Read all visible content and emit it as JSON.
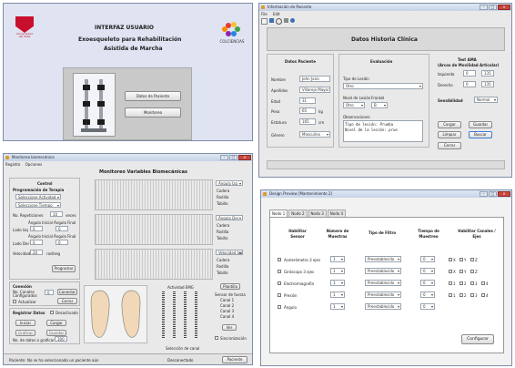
{
  "win1": {
    "title": "INTERFAZ USUARIO",
    "logo_left_text": "Universidad\ndel Valle",
    "subtitle1": "Exoesqueleto para Rehabilitación",
    "subtitle2": "Asistida de Marcha",
    "logo_right_text": "COLCIENCIAS",
    "btn_patient": "Datos de Paciente",
    "btn_monitor": "Monitoreo"
  },
  "win2": {
    "title": "Información de Paciente",
    "menu": [
      "File",
      "Edit"
    ],
    "header": "Datos Historia Clínica",
    "patient_group": "Datos Paciente",
    "labels": {
      "nombre": "Nombre",
      "apellidos": "Apellidos",
      "edad": "Edad",
      "peso": "Peso",
      "estatura": "Estatura",
      "genero": "Género"
    },
    "values": {
      "nombre": "John Jairo",
      "apellidos": "Villarejo Mayor",
      "edad": "31",
      "peso": "65",
      "peso_unit": "kg",
      "estatura": "165",
      "estatura_unit": "cm",
      "genero": "Masculino"
    },
    "eval_group": "Evaluación",
    "tipo_lesion_label": "Tipo de Lesión",
    "tipo_lesion_value": "Otro",
    "nivel_lesion_label": "Nivel de Lesión",
    "nivel_lesion_value": "Otro",
    "frankel_label": "Frankel",
    "frankel_value": "B",
    "obs_label": "Observaciones",
    "obs_text": "Tipo de lesión: Prueba\nNivel de la lesión: prue",
    "test_title": "Test AMA",
    "test_subtitle": "(Arcos de Movilidad Articular)",
    "izquierda_label": "Izquierda",
    "izquierda_value1": "0",
    "izquierda_value2": "135",
    "derecho_label": "Derecho",
    "derecho_value1": "0",
    "derecho_value2": "135",
    "sensibilidad_label": "Sensibilidad",
    "sensibilidad_value": "Normal",
    "btn_cargar": "Cargar",
    "btn_guardar": "Guardar",
    "btn_limpiar": "Limpiar",
    "btn_buscar": "Buscar",
    "btn_cerrar": "Cerrar"
  },
  "win3": {
    "title": "Monitoreo biomecánico",
    "menu": [
      "Registro",
      "Opciones"
    ],
    "header": "Monitoreo Variables Biomecánicas",
    "control_title": "Control",
    "prog_title": "Programación de Terapia",
    "sel1": "Seleccione Actividad",
    "sel2": "Seleccione Tiempo",
    "repeticiones_label": "No. Repeticiones",
    "repeticiones_value": "10",
    "repeticiones_unit": "veces",
    "lado_izq": "Lado Izq",
    "lado_der": "Lado Der",
    "angulo_inicial": "Ángulo Inicial",
    "angulo_final": "Ángulo Final",
    "ang_vals": [
      "0",
      "0",
      "0",
      "0"
    ],
    "velocidad_label": "Velocidad",
    "velocidad_value": "20",
    "velocidad_unit": "rad/seg",
    "btn_programar": "Programar",
    "conexion_title": "Conexión",
    "canales_label": "No. Canales Configurados",
    "canales_value": "0",
    "btn_conectar": "Conectar",
    "btn_cerrar": "Cerrar",
    "actualizar_label": "Actualizar",
    "registrar_title": "Registrar Datos",
    "desactivado_label": "Desactivado",
    "btn_iniciar": "Iniciar",
    "btn_cargar": "Cargar",
    "btn_graficar": "Graficar",
    "btn_guardar": "Guardar",
    "datos_grafica_label": "No. de datos a graficar",
    "datos_grafica_value": "300",
    "angle_selects": [
      "Ángulo Izq",
      "Ángulo Der",
      "Velocidad Izq"
    ],
    "joint_labels": [
      "Cadera",
      "Rodilla",
      "Tobillo"
    ],
    "actividad_emg": "Actividad EMG",
    "btn_plantilla": "Plantilla",
    "sensor_fuerza": "Sensor de fuerza",
    "canales": [
      "Canal 1",
      "Canal 2",
      "Canal 3",
      "Canal 4"
    ],
    "seleccion_canal": "Selección de canal",
    "btn_ver": "Ver",
    "sinc_label": "Sincronización",
    "status_patient_label": "Paciente:",
    "status_patient_value": "No se ha seleccionado un paciente aún",
    "status_conn": "Desconectado",
    "btn_paciente": "Paciente"
  },
  "win4": {
    "title": "Design Preview [Mantenimiento 2]",
    "tabs": [
      "Nodo 1",
      "Nodo 2",
      "Nodo 3",
      "Nodo 4"
    ],
    "col_habilitar": "Habilitar Sensor",
    "col_muestras": "Número de Muestras",
    "col_filtro": "Tipo de Filtro",
    "col_tiempo": "Tiempo de Muestreo",
    "col_canales": "Habilitar Canales / Ejes",
    "rows": [
      {
        "name": "Acelerómetro 3 ejes",
        "muestras": "1",
        "filtro": "Preestablecido",
        "tiempo": "0",
        "axes": [
          "X",
          "Y",
          "Z"
        ]
      },
      {
        "name": "Giróscopo 3 ejes",
        "muestras": "1",
        "filtro": "Preestablecido",
        "tiempo": "0",
        "axes": [
          "X",
          "Y",
          "Z"
        ]
      },
      {
        "name": "Electromiografía",
        "muestras": "1",
        "filtro": "Preestablecido",
        "tiempo": "0",
        "axes": [
          "1",
          "2",
          "3",
          "4"
        ]
      },
      {
        "name": "Presión",
        "muestras": "1",
        "filtro": "Preestablecido",
        "tiempo": "0",
        "axes": [
          "1",
          "2",
          "3",
          "4"
        ]
      },
      {
        "name": "Ángulo",
        "muestras": "1",
        "filtro": "Preestablecido",
        "tiempo": "0",
        "axes": []
      }
    ],
    "btn_configurar": "Configurar"
  }
}
